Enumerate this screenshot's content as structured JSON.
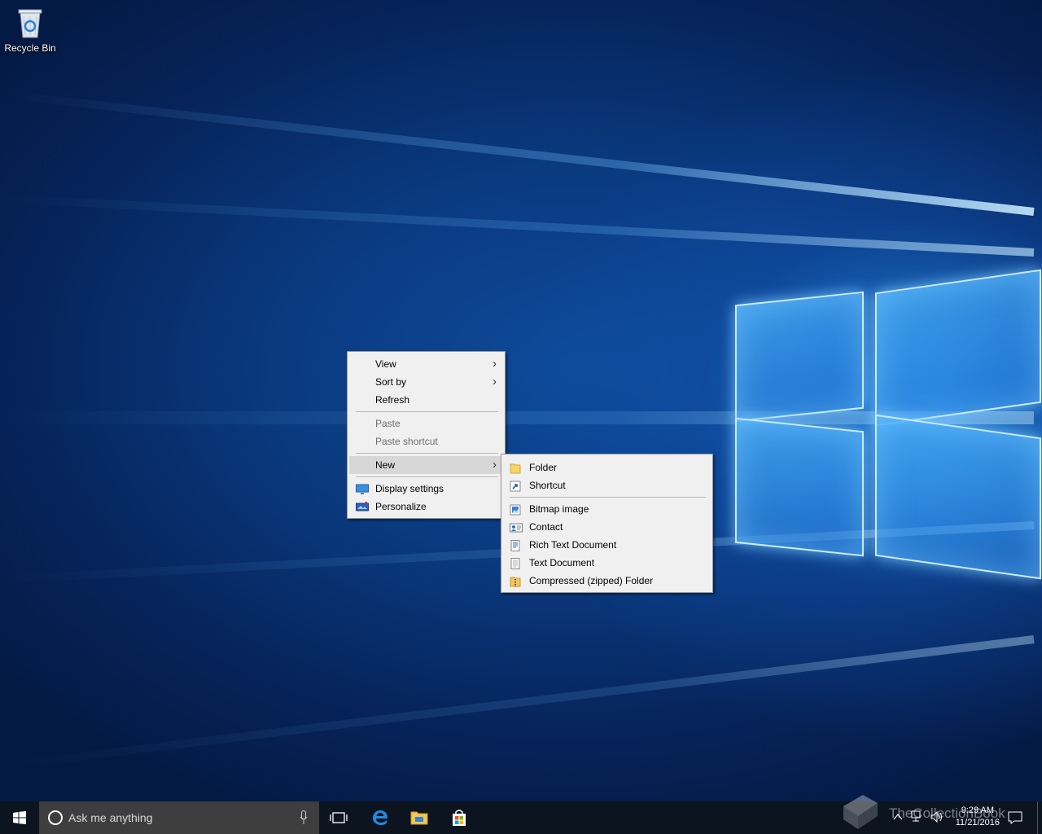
{
  "desktop": {
    "recycle_bin_label": "Recycle Bin"
  },
  "context_menu": {
    "items": [
      {
        "label": "View",
        "has_submenu": true
      },
      {
        "label": "Sort by",
        "has_submenu": true
      },
      {
        "label": "Refresh"
      },
      {
        "label": "Paste",
        "disabled": true
      },
      {
        "label": "Paste shortcut",
        "disabled": true
      },
      {
        "label": "New",
        "has_submenu": true,
        "highlighted": true
      },
      {
        "label": "Display settings",
        "icon": "display-settings-icon"
      },
      {
        "label": "Personalize",
        "icon": "personalize-icon"
      }
    ]
  },
  "new_submenu": {
    "items": [
      {
        "label": "Folder",
        "icon": "folder-icon"
      },
      {
        "label": "Shortcut",
        "icon": "shortcut-icon"
      },
      {
        "label": "Bitmap image",
        "icon": "bitmap-icon"
      },
      {
        "label": "Contact",
        "icon": "contact-icon"
      },
      {
        "label": "Rich Text Document",
        "icon": "rich-text-icon"
      },
      {
        "label": "Text Document",
        "icon": "text-document-icon"
      },
      {
        "label": "Compressed (zipped) Folder",
        "icon": "zip-folder-icon"
      }
    ]
  },
  "taskbar": {
    "search_placeholder": "Ask me anything",
    "time": "9:29 AM",
    "date": "11/21/2016",
    "watermark": "TheCollectionBook"
  },
  "colors": {
    "taskbar": "#0c1420",
    "search_box": "#3e3e3e",
    "menu_bg": "#f0f0f0",
    "menu_highlight": "#d7d7d7"
  }
}
